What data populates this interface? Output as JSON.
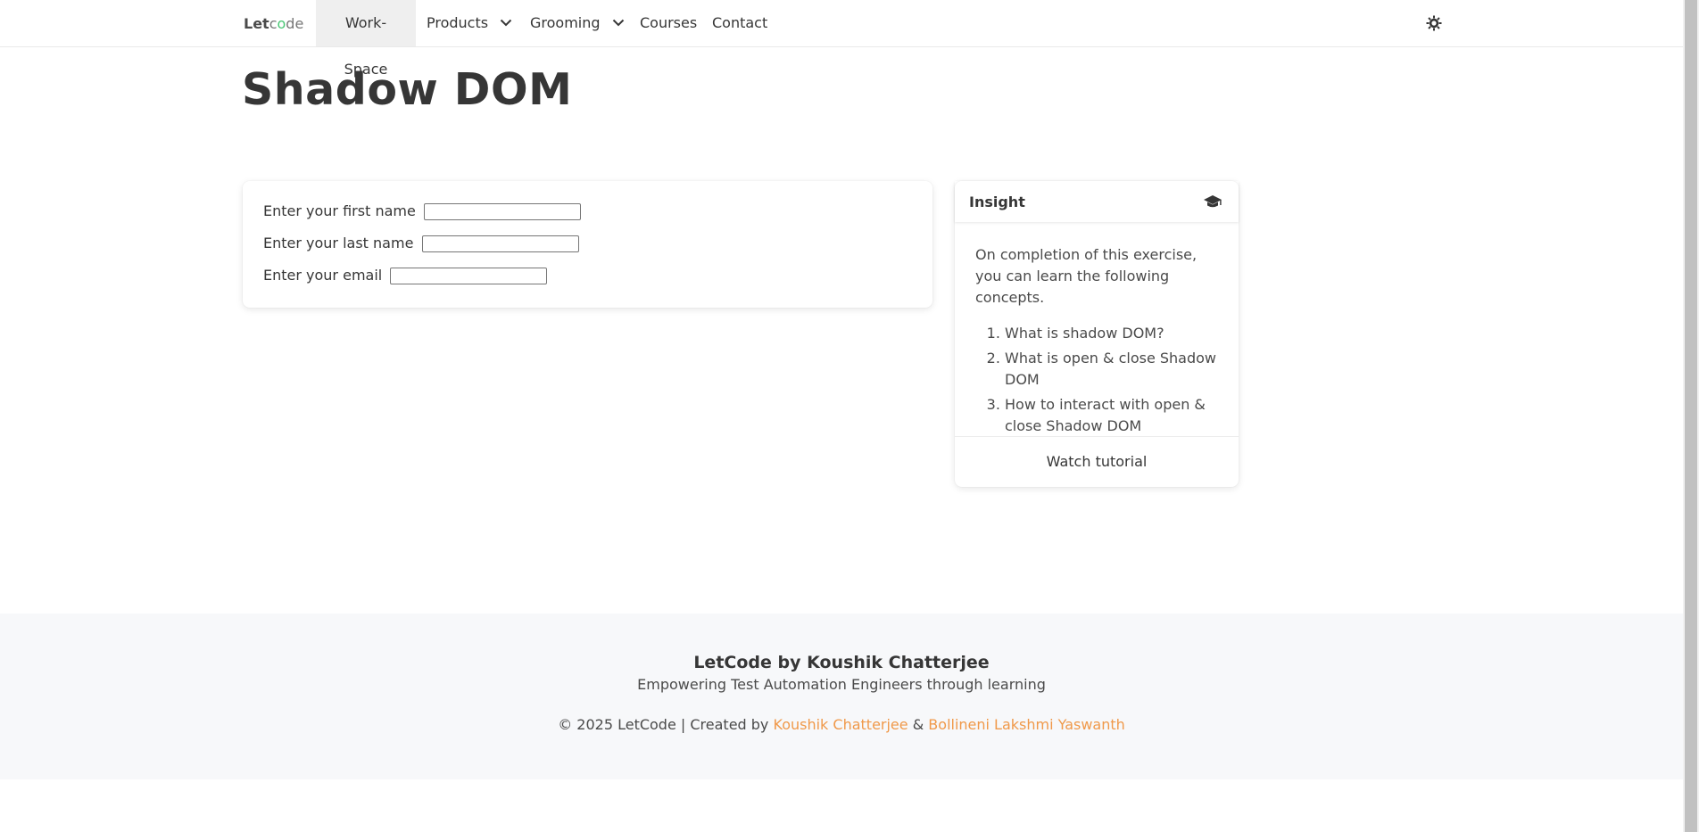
{
  "nav": {
    "brand": {
      "part1": "Let",
      "part2": "c",
      "part3": "o",
      "part4": "de"
    },
    "items": [
      {
        "label": "Work-Space"
      },
      {
        "label": "Products"
      },
      {
        "label": "Grooming"
      },
      {
        "label": "Courses"
      },
      {
        "label": "Contact"
      }
    ],
    "theme_icon": "sun-gear-icon"
  },
  "page": {
    "title": "Shadow DOM"
  },
  "form": {
    "first_name_label": "Enter your first name",
    "last_name_label": "Enter your last name",
    "email_label": "Enter your email",
    "first_name_value": "",
    "last_name_value": "",
    "email_value": ""
  },
  "insight": {
    "title": "Insight",
    "icon": "graduation-cap-icon",
    "intro": "On completion of this exercise, you can learn the following concepts.",
    "items": [
      "What is shadow DOM?",
      "What is open & close Shadow DOM",
      "How to interact with open & close Shadow DOM"
    ],
    "footer_link": "Watch tutorial"
  },
  "footer": {
    "title": "LetCode by Koushik Chatterjee",
    "subtitle": "Empowering Test Automation Engineers through learning",
    "copyright": "© 2025 LetCode | Created by",
    "author1": "Koushik Chatterjee",
    "separator": "&",
    "author2": "Bollineni Lakshmi Yaswanth"
  },
  "colors": {
    "accent_link": "#f0994a",
    "brand_green": "#48c774",
    "text": "#363636"
  }
}
